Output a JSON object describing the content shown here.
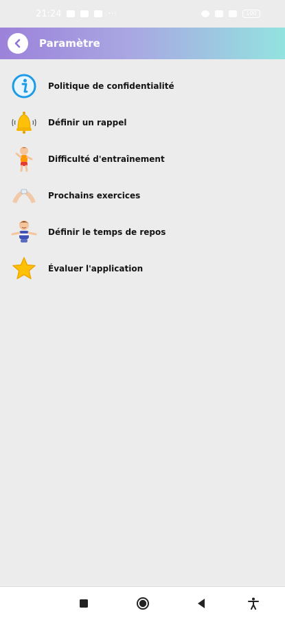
{
  "status_bar": {
    "time": "21:24",
    "left_icons": [
      "trash-icon",
      "youtube-icon",
      "download-icon",
      "more-dots-icon"
    ],
    "more": "···",
    "right_icons": [
      "moon-icon",
      "sim-icon",
      "signal-icon",
      "battery-icon"
    ],
    "battery": "100"
  },
  "app_bar": {
    "title": "Paramètre",
    "back_icon": "back-chevron-icon"
  },
  "settings": [
    {
      "label": "Politique de confidentialité",
      "icon": "info-icon"
    },
    {
      "label": "Définir un rappel",
      "icon": "bell-icon"
    },
    {
      "label": "Difficulté d'entraînement",
      "icon": "kid-exercise-icon"
    },
    {
      "label": "Prochains exercices",
      "icon": "hands-icon"
    },
    {
      "label": "Définir le temps de repos",
      "icon": "kid-rest-icon"
    },
    {
      "label": "Évaluer l'application",
      "icon": "star-icon"
    }
  ],
  "nav_bar": {
    "recent_icon": "square-icon",
    "home_icon": "circle-icon",
    "back_icon": "triangle-back-icon",
    "accessibility_icon": "accessibility-icon"
  }
}
